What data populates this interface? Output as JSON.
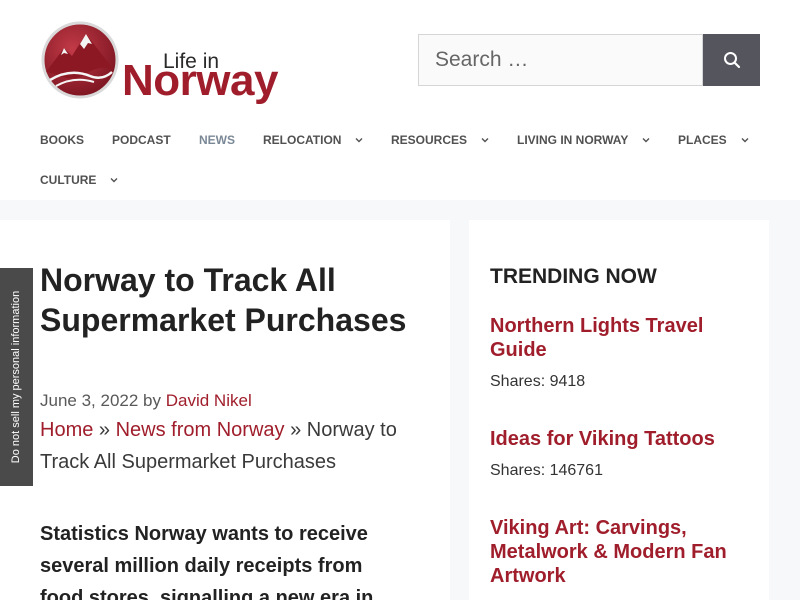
{
  "site": {
    "logo_small": "Life in",
    "logo_big": "Norway"
  },
  "search": {
    "placeholder": "Search …",
    "icon": "search-icon"
  },
  "nav": {
    "items": [
      {
        "label": "Books",
        "has_dropdown": false
      },
      {
        "label": "Podcast",
        "has_dropdown": false
      },
      {
        "label": "News",
        "has_dropdown": false,
        "current": true
      },
      {
        "label": "Relocation",
        "has_dropdown": true
      },
      {
        "label": "Resources",
        "has_dropdown": true
      },
      {
        "label": "Living in Norway",
        "has_dropdown": true
      },
      {
        "label": "Places",
        "has_dropdown": true
      },
      {
        "label": "Culture",
        "has_dropdown": true
      }
    ],
    "current_color": "#7a8896"
  },
  "article": {
    "title": "Norway to Track All Supermarket Purchases",
    "date": "June 3, 2022",
    "by": "by",
    "author": "David Nikel",
    "breadcrumb": {
      "home": "Home",
      "sep": "»",
      "section": "News from Norway",
      "current": "Norway to Track All Supermarket Purchases"
    },
    "lead": "Statistics Norway wants to receive several million daily receipts from food stores, signalling a new era in"
  },
  "sidebar": {
    "title": "TRENDING NOW",
    "items": [
      {
        "title": "Northern Lights Travel Guide",
        "shares": "Shares: 9418"
      },
      {
        "title": "Ideas for Viking Tattoos",
        "shares": "Shares: 146761"
      },
      {
        "title": "Viking Art: Carvings, Metalwork & Modern Fan Artwork"
      }
    ]
  },
  "privacy": {
    "label": "Do not sell my personal information"
  },
  "colors": {
    "brand": "#a01e2c",
    "search_button": "#55555e",
    "page_bg": "#f7f8f9"
  }
}
